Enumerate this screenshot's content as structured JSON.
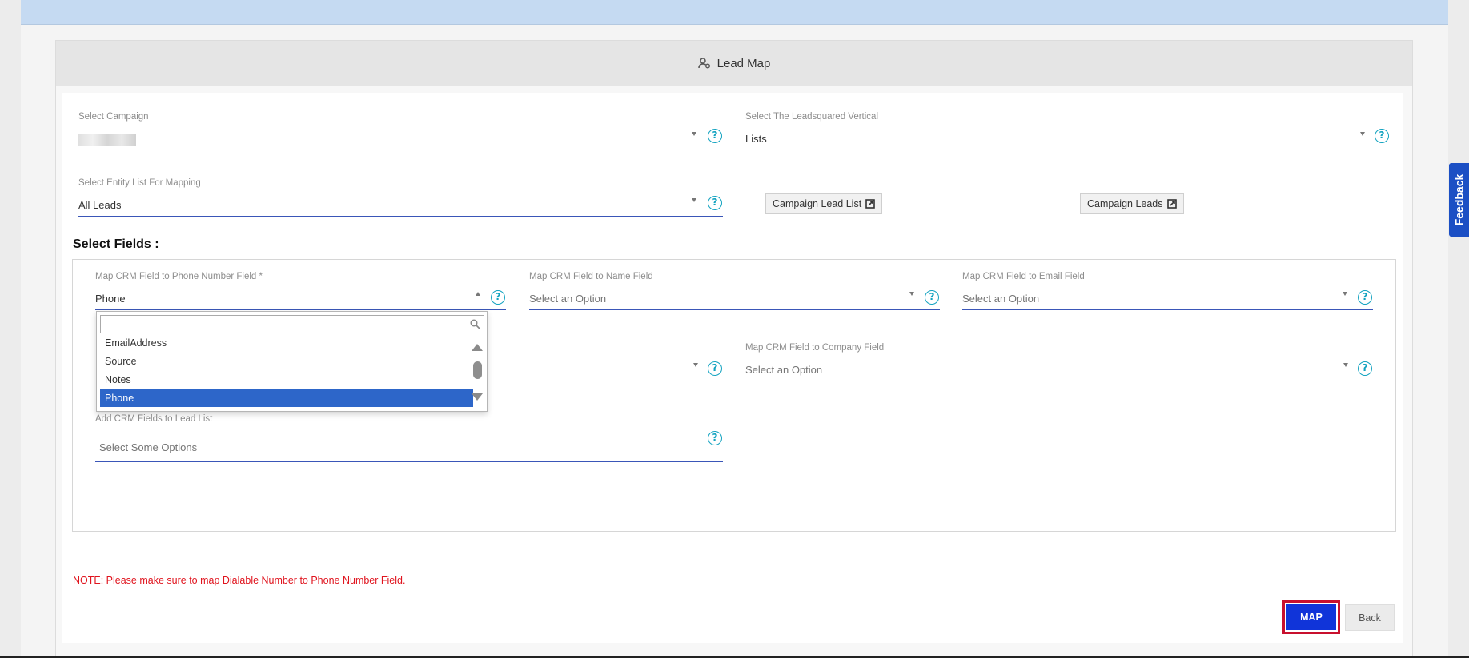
{
  "header": {
    "title": "Lead Map",
    "icon": "user-gear-icon"
  },
  "campaign": {
    "label": "Select Campaign",
    "value": ""
  },
  "vertical": {
    "label": "Select The Leadsquared Vertical",
    "value": "Lists"
  },
  "entity_list": {
    "label": "Select Entity List For Mapping",
    "value": "All Leads"
  },
  "links": {
    "campaign_lead_list": "Campaign Lead List",
    "campaign_leads": "Campaign Leads"
  },
  "section": {
    "title": "Select Fields :"
  },
  "fields": {
    "phone": {
      "label": "Map CRM Field to Phone Number Field *",
      "value": "Phone"
    },
    "name": {
      "label": "Map CRM Field to Name Field",
      "placeholder": "Select an Option"
    },
    "email": {
      "label": "Map CRM Field to Email Field",
      "placeholder": "Select an Option"
    },
    "company": {
      "label": "Map CRM Field to Company Field",
      "placeholder": "Select an Option"
    },
    "lead_list": {
      "label": "Add CRM Fields to Lead List",
      "placeholder": "Select Some Options"
    }
  },
  "dropdown": {
    "items": [
      "EmailAddress",
      "Source",
      "Notes",
      "Phone"
    ],
    "selected": "Phone"
  },
  "note": "NOTE: Please make sure to map Dialable Number to Phone Number Field.",
  "buttons": {
    "map": "MAP",
    "back": "Back"
  },
  "feedback": "Feedback",
  "help_glyph": "?",
  "colors": {
    "accent": "#1034d9",
    "underline": "#3a56b8",
    "help": "#13a3c0",
    "note": "#e0141e",
    "selected": "#2d66c9"
  }
}
